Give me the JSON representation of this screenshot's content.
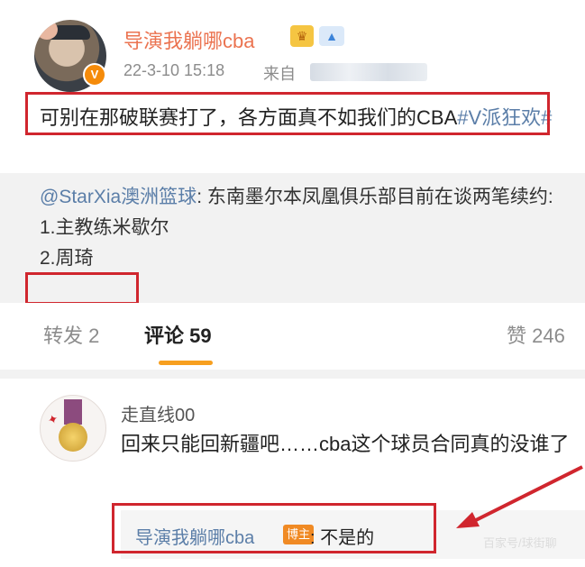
{
  "post": {
    "username": "导演我躺哪cba",
    "verified_badge": "V",
    "badges": [
      "crown-icon",
      "shark-icon"
    ],
    "time": "22-3-10 15:18",
    "source_prefix": "来自",
    "text_main": "可别在那破联赛打了，各方面真不如我们的CBA",
    "topic": "#V派狂欢#"
  },
  "repost": {
    "at_user": "@StarXia澳洲篮球",
    "text_1": ": 东南墨尔本凤凰俱乐部目前在谈两笔续约:",
    "line_2": "1.主教练米歇尔",
    "line_3": "2.周琦"
  },
  "tabs": {
    "repost_label": "转发 2",
    "comment_label": "评论 59",
    "like_label": "赞 246"
  },
  "comment": {
    "username": "走直线00",
    "text": "回来只能回新疆吧……cba这个球员合同真的没谁了",
    "reply": {
      "username": "导演我躺哪cba",
      "badge": "博主",
      "text": ": 不是的"
    }
  },
  "watermark": "百家号/球街聊",
  "colors": {
    "accent_orange": "#eb7350",
    "link_blue": "#5b7ea8",
    "highlight_red": "#d0262e",
    "tab_indicator": "#f79f1f"
  }
}
